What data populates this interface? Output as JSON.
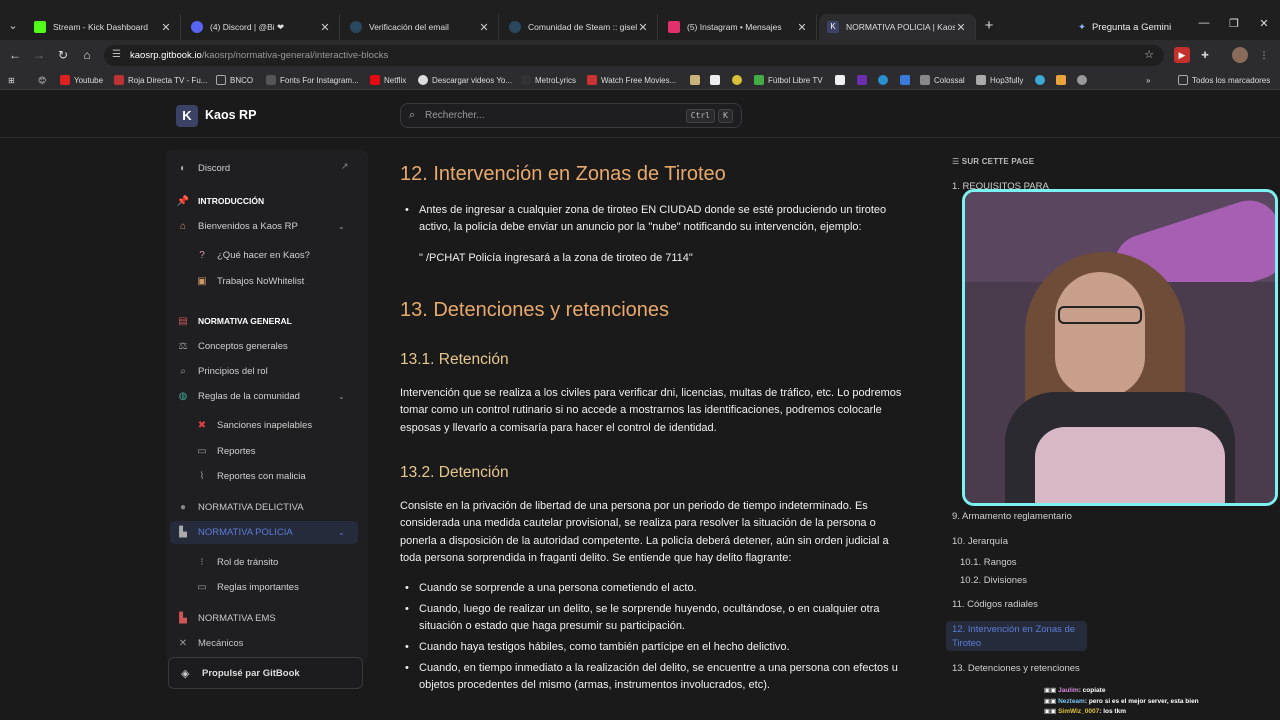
{
  "browser": {
    "tabs": [
      {
        "title": "Stream - Kick Dashboard",
        "color": "#53fc18"
      },
      {
        "title": "(4) Discord | @Bi ❤",
        "color": "#5865f2"
      },
      {
        "title": "Verificación del email",
        "color": "#1b2838"
      },
      {
        "title": "Comunidad de Steam :: giselma",
        "color": "#1b2838"
      },
      {
        "title": "(5) Instagram • Mensajes",
        "color": "#e1306c"
      },
      {
        "title": "NORMATIVA POLICIA | Kaos RP",
        "color": "#3b4266"
      }
    ],
    "gemini_label": "Pregunta a Gemini",
    "url_domain": "kaosrp.gitbook.io",
    "url_path": "/kaosrp/normativa-general/interactive-blocks",
    "bookmarks": [
      "Youtube",
      "Roja Directa TV - Fu...",
      "BNCO",
      "Fonts For Instagram...",
      "Netflix",
      "Descargar videos Yo...",
      "MetroLyrics",
      "Watch Free Movies...",
      "Fútbol Libre TV",
      "Colossal",
      "Hop3fully"
    ],
    "all_bookmarks": "Todos los marcadores"
  },
  "site": {
    "logo_letter": "K",
    "name": "Kaos RP",
    "search_placeholder": "Rechercher...",
    "shortcut_ctrl": "Ctrl",
    "shortcut_key": "K"
  },
  "sidebar": {
    "discord": "Discord",
    "introduccion": "INTRODUCCIÓN",
    "bienvenidos": "Bienvenidos a Kaos RP",
    "que_hacer": "¿Qué hacer en Kaos?",
    "trabajos": "Trabajos NoWhitelist",
    "normativa_general": "NORMATIVA GENERAL",
    "conceptos": "Conceptos generales",
    "principios": "Principios del rol",
    "reglas": "Reglas de la comunidad",
    "sanciones": "Sanciones inapelables",
    "reportes": "Reportes",
    "reportes_malicia": "Reportes con malicia",
    "normativa_delictiva": "NORMATIVA DELICTIVA",
    "normativa_policia": "NORMATIVA POLICIA",
    "rol_transito": "Rol de tránsito",
    "reglas_importantes": "Reglas importantes",
    "normativa_ems": "NORMATIVA EMS",
    "mecanicos": "Mecánicos",
    "gitbook": "Propulsé par GitBook"
  },
  "content": {
    "h12": "12. Intervención en Zonas de Tiroteo",
    "p12": "Antes de ingresar a cualquier zona de tiroteo EN CIUDAD donde se esté produciendo un tiroteo activo, la policía debe enviar un anuncio por la \"nube\" notificando su intervención, ejemplo:",
    "quote": "\" /PCHAT Policía ingresará a la zona de tiroteo de 7114\"",
    "h13": "13. Detenciones y retenciones",
    "h131": "13.1. Retención",
    "p131": "Intervención que se realiza a los civiles para verificar dni, licencias, multas de tráfico, etc. Lo podremos tomar como un control rutinario si no accede a mostrarnos las identificaciones, podremos colocarle esposas y llevarlo a comisaría para hacer el control de identidad.",
    "h132": "13.2. Detención",
    "p132": "Consiste en la privación de libertad de una persona por un periodo de tiempo indeterminado. Es considerada una medida cautelar provisional, se realiza para resolver la situación de la persona o ponerla a disposición de la autoridad competente. La policía deberá detener, aún sin orden judicial a toda persona sorprendida in fraganti delito. Se entiende que hay delito flagrante:",
    "b1": "Cuando se sorprende a una persona cometiendo el acto.",
    "b2": "Cuando, luego de realizar un delito, se le sorprende huyendo, ocultándose, o en cualquier otra situación o estado que haga presumir su participación.",
    "b3": "Cuando haya testigos hábiles, como también partícipe en el hecho delictivo.",
    "b4": "Cuando, en tiempo inmediato a la realización del delito, se encuentre a una persona con efectos u objetos procedentes del mismo (armas, instrumentos involucrados, etc)."
  },
  "toc": {
    "title": "SUR CETTE PAGE",
    "i1": "1. REQUISITOS PARA",
    "i9": "9. Armamento reglamentario",
    "i10": "10. Jerarquía",
    "i101": "10.1. Rangos",
    "i102": "10.2. Divisiones",
    "i11": "11. Códigos radiales",
    "i12": "12. Intervención en Zonas de Tiroteo",
    "i13": "13. Detenciones y retenciones"
  },
  "chat": [
    {
      "user": "Jaulim",
      "msg": "copiate"
    },
    {
      "user": "Nezteam",
      "msg": "pero si es el mejor server, esta bien"
    },
    {
      "user": "SimWiz_0007",
      "msg": "los tkm"
    }
  ]
}
